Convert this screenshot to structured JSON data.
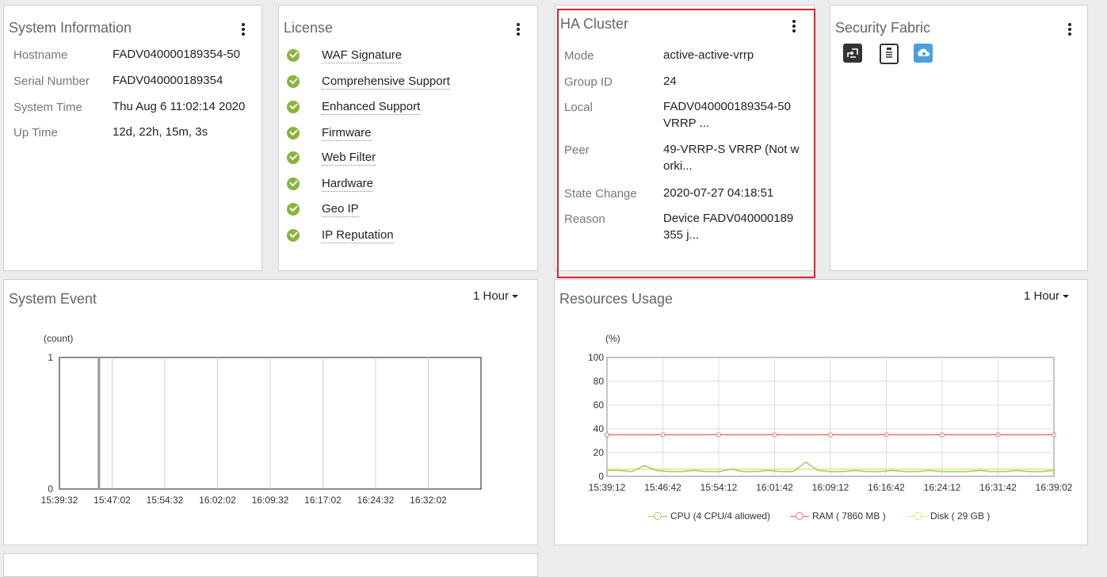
{
  "system_info": {
    "title": "System Information",
    "rows": [
      {
        "label": "Hostname",
        "value": "FADV040000189354-50"
      },
      {
        "label": "Serial Number",
        "value": "FADV040000189354"
      },
      {
        "label": "System Time",
        "value": "Thu Aug 6 11:02:14 2020"
      },
      {
        "label": "Up Time",
        "value": "12d, 22h, 15m, 3s"
      }
    ]
  },
  "license": {
    "title": "License",
    "items": [
      "WAF Signature",
      "Comprehensive Support",
      "Enhanced Support",
      "Firmware",
      "Web Filter",
      "Hardware",
      "Geo IP",
      "IP Reputation"
    ],
    "check_color": "#8ab43c"
  },
  "ha_cluster": {
    "title": "HA Cluster",
    "highlight_color": "#d9232d",
    "rows": [
      {
        "label": "Mode",
        "value": "active-active-vrrp"
      },
      {
        "label": "Group ID",
        "value": "24"
      },
      {
        "label": "Local",
        "value": "FADV040000189354-50",
        "value2": "VRRP ..."
      },
      {
        "label": "Peer",
        "value": "49-VRRP-S VRRP (Not w",
        "value2": "orki..."
      },
      {
        "label": "State Change",
        "value": "2020-07-27 04:18:51"
      },
      {
        "label": "Reason",
        "value": "Device FADV040000189",
        "value2": "355 j..."
      }
    ]
  },
  "security_fabric": {
    "title": "Security Fabric",
    "icons": [
      "topology-icon",
      "clipboard-icon",
      "cloud-icon"
    ]
  },
  "system_event": {
    "title": "System Event",
    "range_label": "1 Hour"
  },
  "resources_usage": {
    "title": "Resources Usage",
    "range_label": "1 Hour",
    "legend": [
      {
        "label": "CPU (4 CPU/4 allowed)",
        "color": "#9ccc65"
      },
      {
        "label": "RAM ( 7860 MB )",
        "color": "#e57373"
      },
      {
        "label": "Disk ( 29 GB )",
        "color": "#dce775"
      }
    ]
  },
  "chart_data": [
    {
      "type": "line",
      "title": "System Event",
      "ylabel": "(count)",
      "ylim": [
        0,
        1
      ],
      "y_ticks": [
        "0",
        "1"
      ],
      "x_ticks": [
        "15:39:32",
        "15:47:02",
        "15:54:32",
        "16:02:02",
        "16:09:32",
        "16:17:02",
        "16:24:32",
        "16:32:02"
      ],
      "series": [
        {
          "x": [
            "15:39:32",
            "15:46:40",
            "15:46:41",
            "15:46:42",
            "15:54:32",
            "16:02:02",
            "16:09:32",
            "16:17:02",
            "16:24:32",
            "16:32:02"
          ],
          "values": [
            0,
            0,
            1,
            0,
            0,
            0,
            0,
            0,
            0,
            0
          ]
        }
      ],
      "grid": true
    },
    {
      "type": "line",
      "title": "Resources Usage",
      "ylabel": "(%)",
      "ylim": [
        0,
        100
      ],
      "y_ticks": [
        "0",
        "20",
        "40",
        "60",
        "80",
        "100"
      ],
      "x_ticks": [
        "15:39:12",
        "15:46:42",
        "15:54:12",
        "16:01:42",
        "16:09:12",
        "16:16:42",
        "16:24:12",
        "16:31:42",
        "16:39:02"
      ],
      "series": [
        {
          "name": "CPU (4 CPU/4 allowed)",
          "values": [
            5,
            5,
            4,
            9,
            5,
            4,
            4,
            5,
            4,
            4,
            6,
            4,
            4,
            5,
            4,
            4,
            12,
            5,
            4,
            4,
            5,
            4,
            4,
            5,
            4,
            4,
            5,
            4,
            4,
            4,
            5,
            4,
            4,
            5,
            4,
            4,
            5
          ]
        },
        {
          "name": "RAM ( 7860 MB )",
          "values": [
            35,
            35,
            35,
            35,
            35,
            35,
            35,
            35,
            35
          ]
        },
        {
          "name": "Disk ( 29 GB )",
          "values": [
            6,
            6,
            6,
            6,
            6,
            6,
            6,
            6,
            6,
            6,
            6,
            6,
            6,
            6,
            6,
            6,
            6,
            6,
            6,
            6,
            6,
            6,
            6,
            6,
            6,
            6,
            6,
            6,
            6,
            6,
            6,
            6,
            6,
            6,
            6,
            6,
            6
          ]
        }
      ],
      "grid": true,
      "legend_position": "bottom"
    }
  ]
}
